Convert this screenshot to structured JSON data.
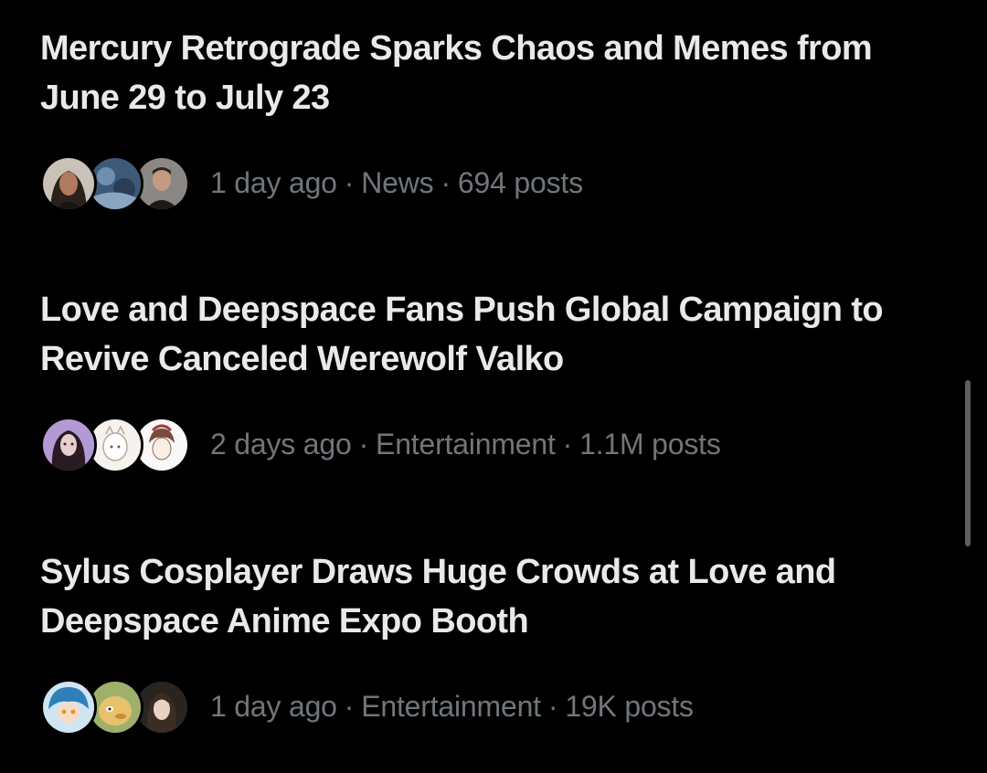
{
  "stories": [
    {
      "title": "Mercury Retrograde Sparks Chaos and Memes from June 29 to July 23",
      "time": "1 day ago",
      "category": "News",
      "posts": "694 posts"
    },
    {
      "title": "Love and Deepspace Fans Push Global Campaign to Revive Canceled Werewolf Valko",
      "time": "2 days ago",
      "category": "Entertainment",
      "posts": "1.1M posts"
    },
    {
      "title": "Sylus Cosplayer Draws Huge Crowds at Love and Deepspace Anime Expo Booth",
      "time": "1 day ago",
      "category": "Entertainment",
      "posts": "19K posts"
    }
  ],
  "separator": "·",
  "colors": {
    "background": "#000000",
    "title": "#e7e9ea",
    "meta": "#71767b",
    "scrollbar": "#5a5d61"
  }
}
